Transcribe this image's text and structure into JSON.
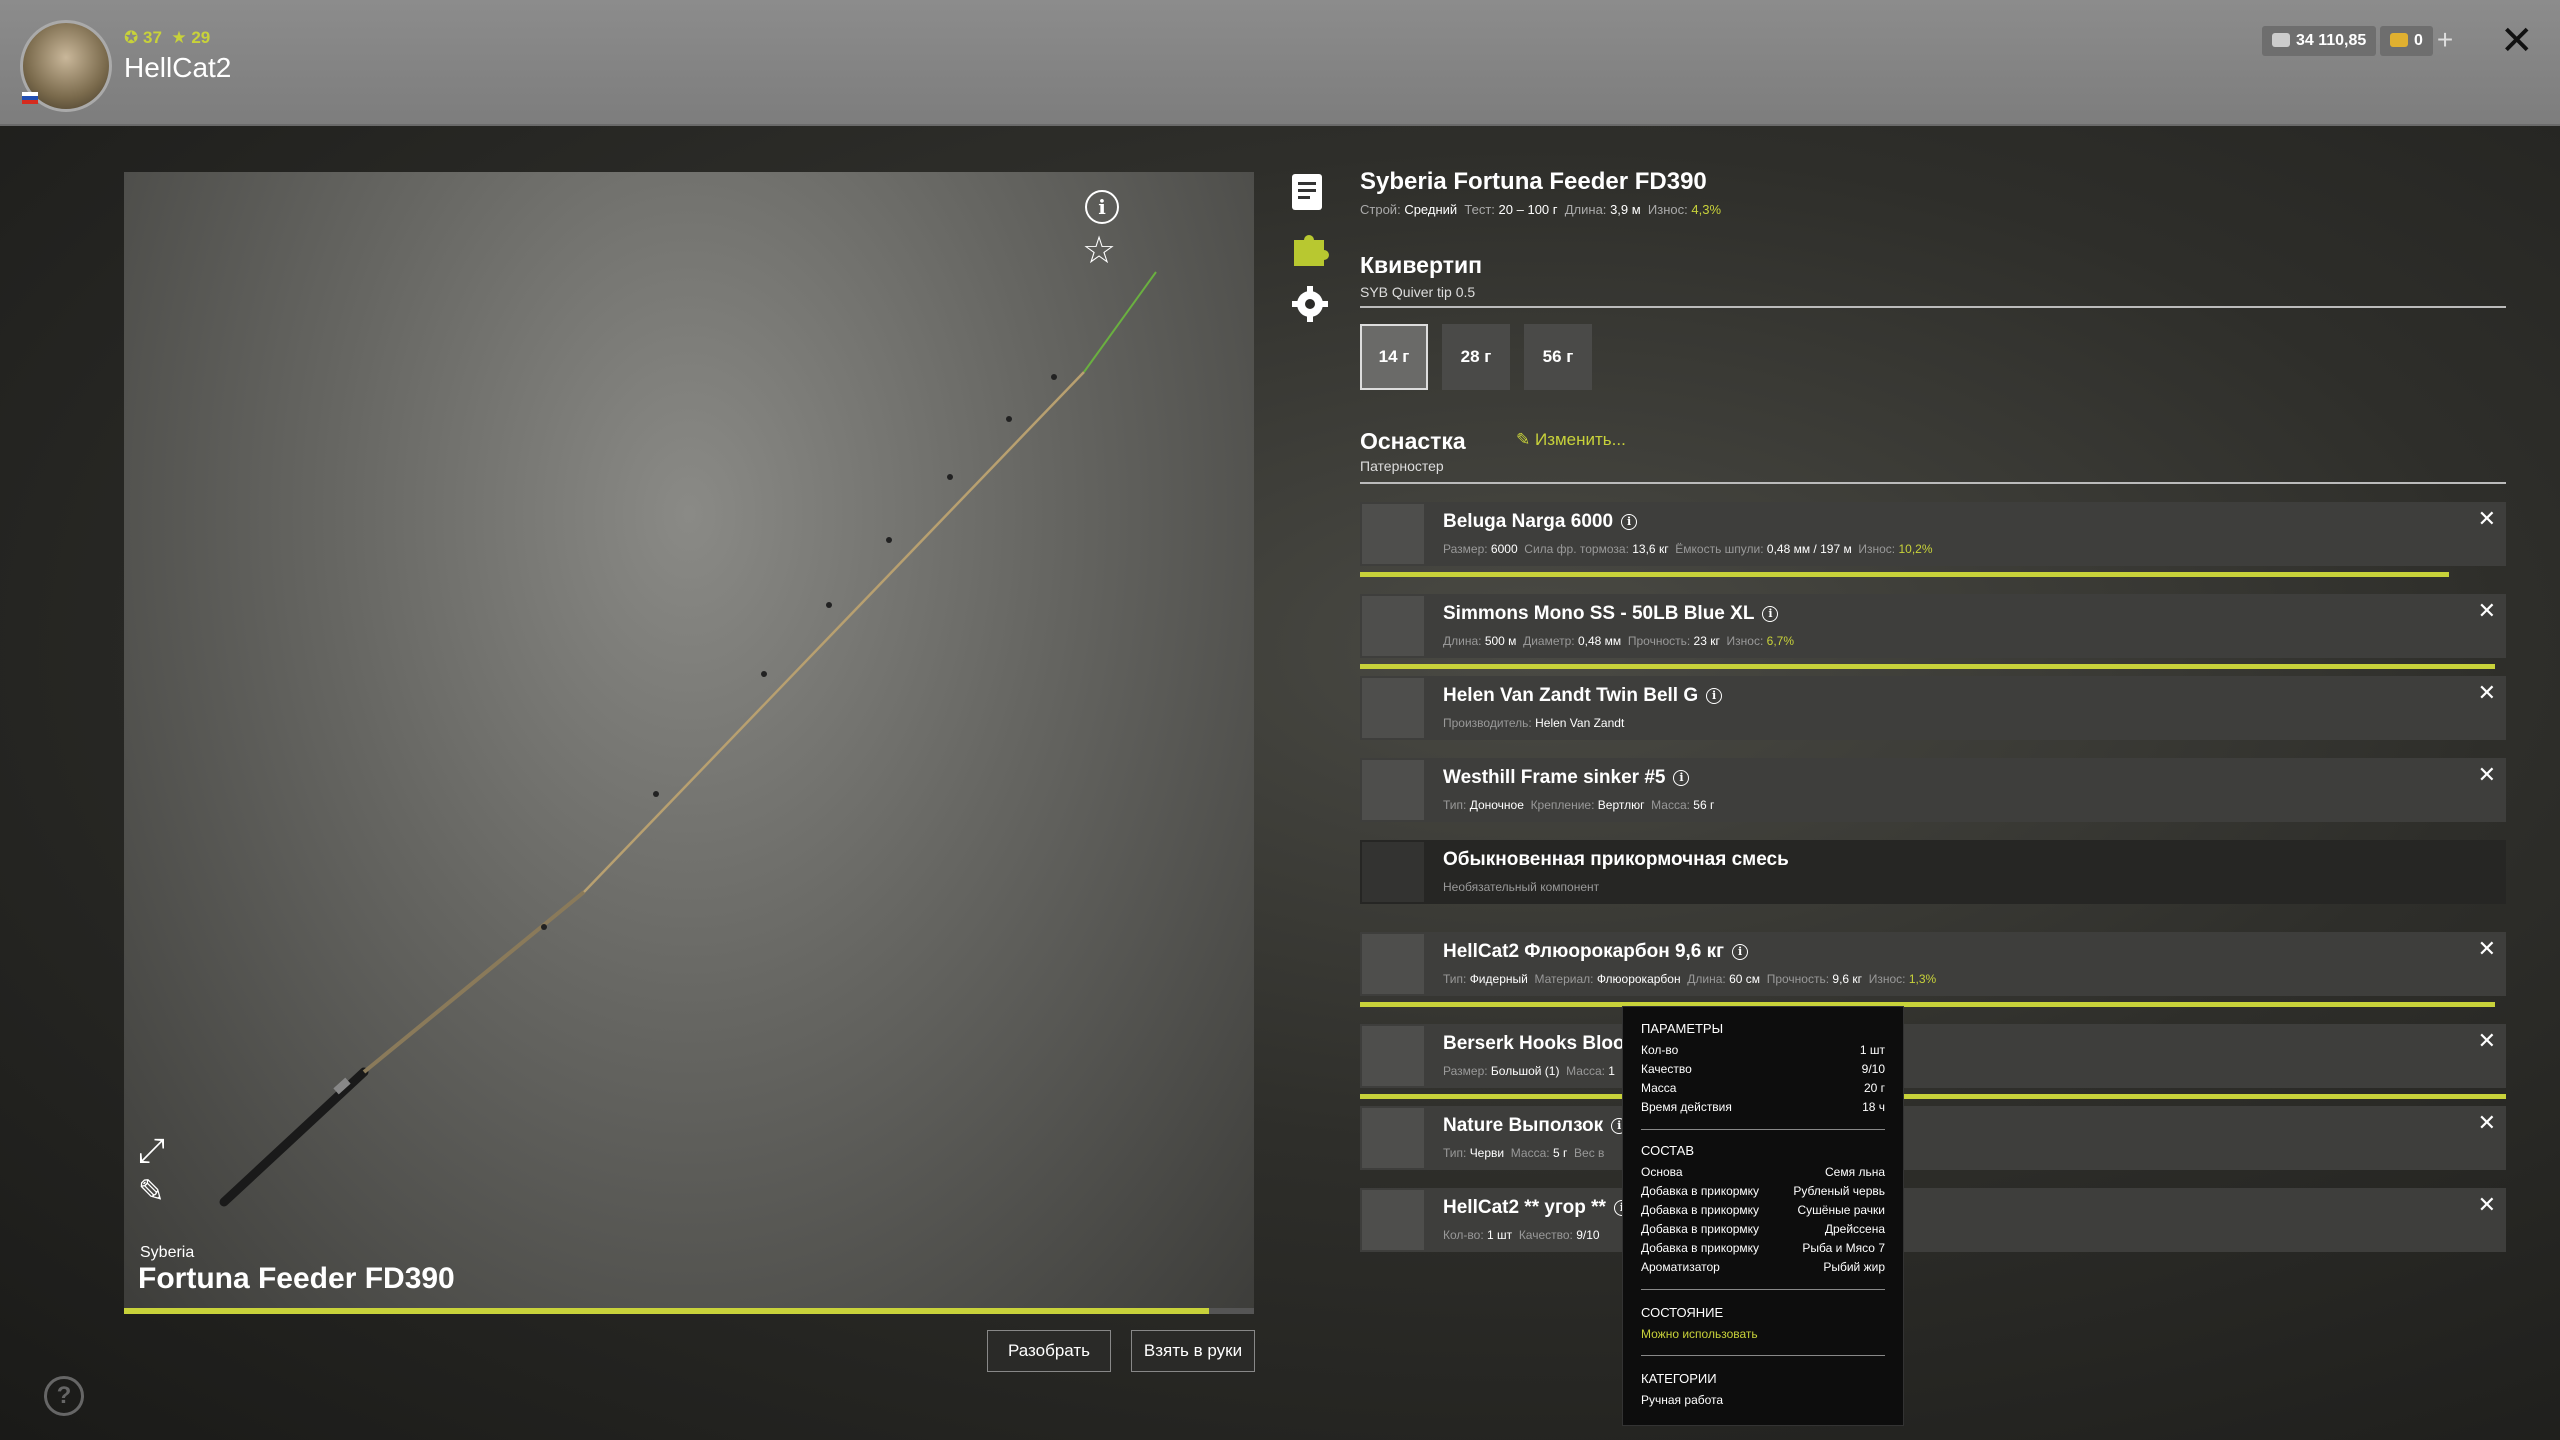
{
  "player": {
    "level": "37",
    "stars": "29",
    "name": "HellCat2"
  },
  "currency": {
    "silver": "34 110,85",
    "gold": "0",
    "add": "+"
  },
  "rod": {
    "brand": "Syberia",
    "name": "Fortuna Feeder FD390",
    "condition_fraction": 0.96
  },
  "buttons": {
    "disassemble": "Разобрать",
    "take": "Взять в руки"
  },
  "details": {
    "title": "Syberia Fortuna Feeder FD390",
    "meta": {
      "action_label": "Строй:",
      "action": "Средний",
      "test_label": "Тест:",
      "test": "20 – 100 г",
      "length_label": "Длина:",
      "length": "3,9 м",
      "wear_label": "Износ:",
      "wear": "4,3%"
    },
    "quiver": {
      "title": "Квивертип",
      "sub": "SYB Quiver tip 0.5",
      "weights": [
        "14 г",
        "28 г",
        "56 г"
      ]
    },
    "rig": {
      "title": "Оснастка",
      "change": "Изменить...",
      "sub": "Патерностер"
    }
  },
  "items": [
    {
      "name": "Beluga Narga 6000",
      "wear_fraction": 0.95,
      "det": [
        [
          "Размер:",
          "6000"
        ],
        [
          "Сила фр. тормоза:",
          "13,6 кг"
        ],
        [
          "Ёмкость шпули:",
          "0,48 мм / 197 м"
        ],
        [
          "Износ:",
          "10,2%"
        ]
      ]
    },
    {
      "name": "Simmons Mono SS - 50LB Blue XL",
      "wear_fraction": 0.99,
      "det": [
        [
          "Длина:",
          "500 м"
        ],
        [
          "Диаметр:",
          "0,48 мм"
        ],
        [
          "Прочность:",
          "23 кг"
        ],
        [
          "Износ:",
          "6,7%"
        ]
      ]
    },
    {
      "name": "Helen Van Zandt Twin Bell G",
      "det": [
        [
          "Производитель:",
          "Helen Van Zandt"
        ]
      ]
    },
    {
      "name": "Westhill Frame sinker #5",
      "det": [
        [
          "Тип:",
          "Доночное"
        ],
        [
          "Крепление:",
          "Вертлюг"
        ],
        [
          "Масса:",
          "56 г"
        ]
      ]
    },
    {
      "name": "Обыкновенная прикормочная смесь",
      "optional": "Необязательный компонент"
    },
    {
      "name": "HellCat2 Флюорокарбон 9,6 кг",
      "wear_fraction": 0.99,
      "det": [
        [
          "Тип:",
          "Фидерный"
        ],
        [
          "Материал:",
          "Флюорокарбон"
        ],
        [
          "Длина:",
          "60 см"
        ],
        [
          "Прочность:",
          "9,6 кг"
        ],
        [
          "Износ:",
          "1,3%"
        ]
      ]
    },
    {
      "name": "Berserk Hooks Bloody",
      "wear_fraction": 1.0,
      "det": [
        [
          "Размер:",
          "Большой (1)"
        ],
        [
          "Масса:",
          "1"
        ]
      ]
    },
    {
      "name": "Nature Выползок",
      "det": [
        [
          "Тип:",
          "Черви"
        ],
        [
          "Масса:",
          "5 г"
        ],
        [
          "Вес в",
          ""
        ]
      ]
    },
    {
      "name": "HellCat2 ** угор **",
      "det": [
        [
          "Кол-во:",
          "1 шт"
        ],
        [
          "Качество:",
          "9/10"
        ]
      ]
    }
  ],
  "tooltip": {
    "params_title": "ПАРАМЕТРЫ",
    "params": [
      [
        "Кол-во",
        "1 шт"
      ],
      [
        "Качество",
        "9/10"
      ],
      [
        "Масса",
        "20 г"
      ],
      [
        "Время действия",
        "18 ч"
      ]
    ],
    "comp_title": "СОСТАВ",
    "comp": [
      [
        "Основа",
        "Семя льна"
      ],
      [
        "Добавка в прикормку",
        "Рубленый червь"
      ],
      [
        "Добавка в прикормку",
        "Сушёные рачки"
      ],
      [
        "Добавка в прикормку",
        "Дрейссена"
      ],
      [
        "Добавка в прикормку",
        "Рыба и Мясо 7"
      ],
      [
        "Ароматизатор",
        "Рыбий жир"
      ]
    ],
    "state_title": "СОСТОЯНИЕ",
    "state": "Можно использовать",
    "cat_title": "КАТЕГОРИИ",
    "cat": "Ручная работа"
  },
  "colors": {
    "accent": "#c8d23a"
  },
  "icons": [
    "info-icon",
    "star-icon",
    "expand-icon",
    "pencil-icon",
    "document-icon",
    "puzzle-icon",
    "gear-icon",
    "edit-icon",
    "close-icon",
    "help-icon"
  ]
}
